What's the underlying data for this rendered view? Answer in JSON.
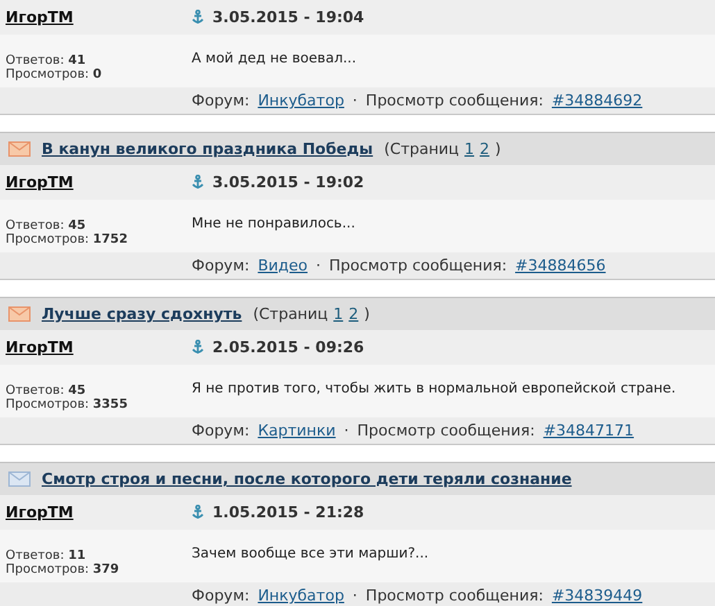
{
  "posts": [
    {
      "author": "ИгорТМ",
      "date": "3.05.2015 - 19:04",
      "replies_label": "Ответов:",
      "replies": "41",
      "views_label": "Просмотров:",
      "views": "0",
      "message": "А мой дед не воевал...",
      "forum_label": "Форум:",
      "forum": "Инкубатор",
      "separator": "·",
      "view_label": "Просмотр сообщения:",
      "post_link": "#34884692"
    },
    {
      "topic": {
        "kind": "hot",
        "title": "В канун великого праздника Победы",
        "pages_label": "(Страниц",
        "pages": [
          "1",
          "2"
        ],
        "pages_end": ")"
      },
      "author": "ИгорТМ",
      "date": "3.05.2015 - 19:02",
      "replies_label": "Ответов:",
      "replies": "45",
      "views_label": "Просмотров:",
      "views": "1752",
      "message": "Мне не понравилось...",
      "forum_label": "Форум:",
      "forum": "Видео",
      "separator": "·",
      "view_label": "Просмотр сообщения:",
      "post_link": "#34884656"
    },
    {
      "topic": {
        "kind": "hot",
        "title": "Лучше сразу сдохнуть",
        "pages_label": "(Страниц",
        "pages": [
          "1",
          "2"
        ],
        "pages_end": ")"
      },
      "author": "ИгорТМ",
      "date": "2.05.2015 - 09:26",
      "replies_label": "Ответов:",
      "replies": "45",
      "views_label": "Просмотров:",
      "views": "3355",
      "message": "Я не против того, чтобы жить в нормальной европейской стране.",
      "forum_label": "Форум:",
      "forum": "Картинки",
      "separator": "·",
      "view_label": "Просмотр сообщения:",
      "post_link": "#34847171"
    },
    {
      "topic": {
        "kind": "normal",
        "title": "Смотр строя и песни, после которого дети теряли сознание"
      },
      "author": "ИгорТМ",
      "date": "1.05.2015 - 21:28",
      "replies_label": "Ответов:",
      "replies": "11",
      "views_label": "Просмотров:",
      "views": "379",
      "message": "Зачем вообще все эти марши?...",
      "forum_label": "Форум:",
      "forum": "Инкубатор",
      "separator": "·",
      "view_label": "Просмотр сообщения:",
      "post_link": "#34839449"
    }
  ]
}
